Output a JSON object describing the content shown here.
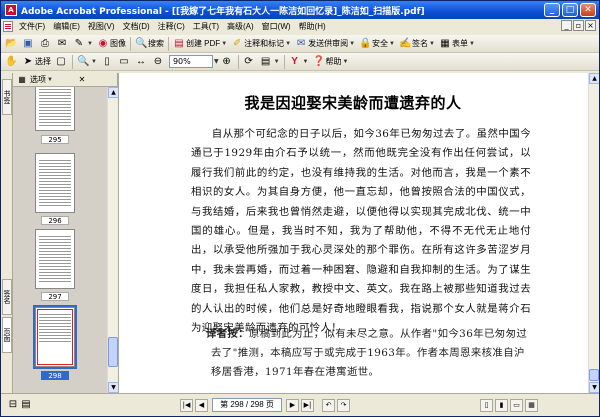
{
  "window": {
    "title": "Adobe Acrobat Professional - [[我嫁了七年我有石大人一陈洁如回忆录]_陈洁如_扫描版.pdf]",
    "app_icon": "pdf-icon"
  },
  "menu": [
    "文件(F)",
    "编辑(E)",
    "视图(V)",
    "文档(D)",
    "注释(C)",
    "工具(T)",
    "高级(A)",
    "窗口(W)",
    "帮助(H)"
  ],
  "toolbar1": {
    "buttons": [
      {
        "icon": "open-icon",
        "label": ""
      },
      {
        "icon": "save-icon",
        "label": ""
      },
      {
        "icon": "print-icon",
        "label": ""
      },
      {
        "icon": "email-icon",
        "label": ""
      },
      {
        "icon": "pen-icon",
        "label": ""
      },
      {
        "icon": "image-icon",
        "label": "图像"
      },
      {
        "icon": "find-icon",
        "label": "搜索"
      }
    ],
    "create_pdf": "创建 PDF",
    "comment": "注释和标记",
    "send_review": "发送供审阅",
    "secure": "安全",
    "sign": "签名",
    "forms": "表单"
  },
  "toolbar2": {
    "select": "选择",
    "zoom_value": "90%",
    "help": "帮助"
  },
  "left_tabs": [
    "书签",
    "签名",
    "页面"
  ],
  "panel": {
    "options": "选项"
  },
  "thumbnails": [
    {
      "label": "295",
      "selected": false
    },
    {
      "label": "296",
      "selected": false
    },
    {
      "label": "297",
      "selected": false
    },
    {
      "label": "298",
      "selected": true
    }
  ],
  "document": {
    "title": "我是因迎娶宋美龄而遭遗弃的人",
    "paragraph": "自从那个可纪念的日子以后，如今36年已匆匆过去了。虽然中国今通已于1929年由介石予以统一，然而他既完全没有作出任何尝试，以履行我们前此的约定，也没有维持我的生活。对他而言，我是一个素不相识的女人。为其自身方便，他一直忘却，他曾按照合法的中国仪式，与我结婚，后来我也曾悄然走避，以便他得以实现其完成北伐、统一中国的雄心。但是，我当时不知，我为了帮助他，不得不无代无止地付出，以承受他所强加于我心灵深处的那个罪伤。在所有这许多苦涩岁月中，我未尝再婚，而过着一种困窘、隐避和自我抑制的生活。为了谋生度日，我担任私人家教，教授中文、英文。我在路上被那些知道我过去的人认出的时候，他们总是好奇地瞪眼看我，指说那个女人就是蒋介石为迎娶宋美龄而遗弃的可怜人！",
    "note_label": "译者按：",
    "note_text": "原稿到此为止，似有未尽之意。从作者\"如今36年已匆匆过去了\"推测，本稿应写于或完成于1963年。作者本周恩来核准自沪移居香港，1971年春在港寓逝世。"
  },
  "statusbar": {
    "page_display": "第 298 / 298 页"
  }
}
